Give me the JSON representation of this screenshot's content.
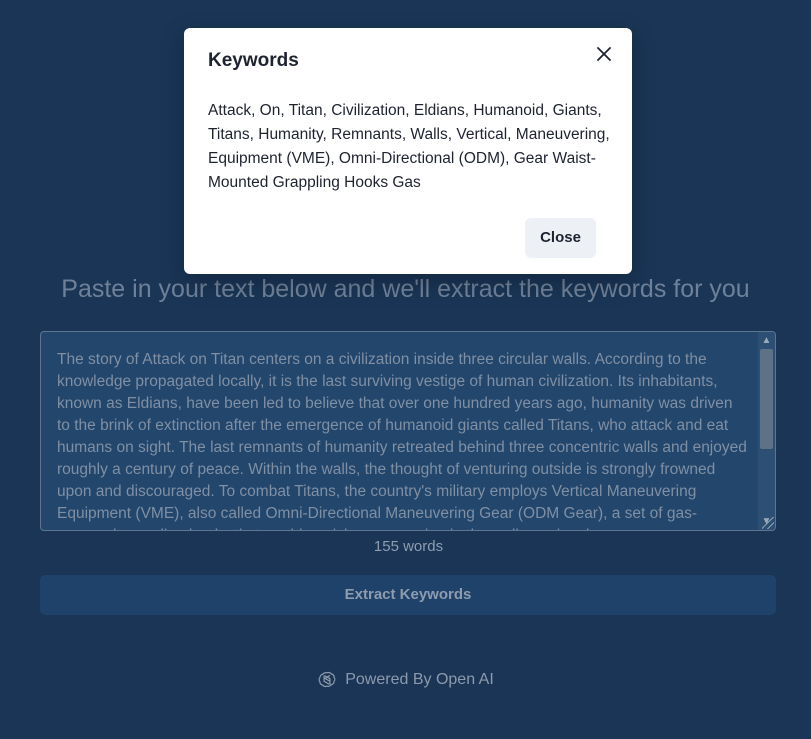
{
  "main": {
    "subtitle": "Paste in your text below and we'll extract the keywords for you",
    "input_text": "The story of Attack on Titan centers on a civilization inside three circular walls. According to the knowledge propagated locally, it is the last surviving vestige of human civilization. Its inhabitants, known as Eldians, have been led to believe that over one hundred years ago, humanity was driven to the brink of extinction after the emergence of humanoid giants called Titans, who attack and eat humans on sight. The last remnants of humanity retreated behind three concentric walls and enjoyed roughly a century of peace. Within the walls, the thought of venturing outside is strongly frowned upon and discouraged. To combat Titans, the country's military employs Vertical Maneuvering Equipment (VME), also called Omni-Directional Maneuvering Gear (ODM Gear), a set of gas-powered grappling hooks that enable quick maneuvering in three-dimensional space.",
    "word_count": "155 words",
    "extract_label": "Extract Keywords"
  },
  "footer": {
    "label": "Powered By Open AI",
    "icon": "openai-logo-icon"
  },
  "modal": {
    "title": "Keywords",
    "keywords": "Attack, On, Titan, Civilization, Eldians, Humanoid, Giants, Titans, Humanity, Remnants, Walls, Vertical, Maneuvering, Equipment (VME), Omni-Directional (ODM), Gear Waist-Mounted Grappling Hooks Gas",
    "close_label": "Close",
    "close_icon": "close-icon"
  },
  "colors": {
    "background": "#1a3556",
    "button": "#1f426a",
    "modal_bg": "#ffffff"
  }
}
